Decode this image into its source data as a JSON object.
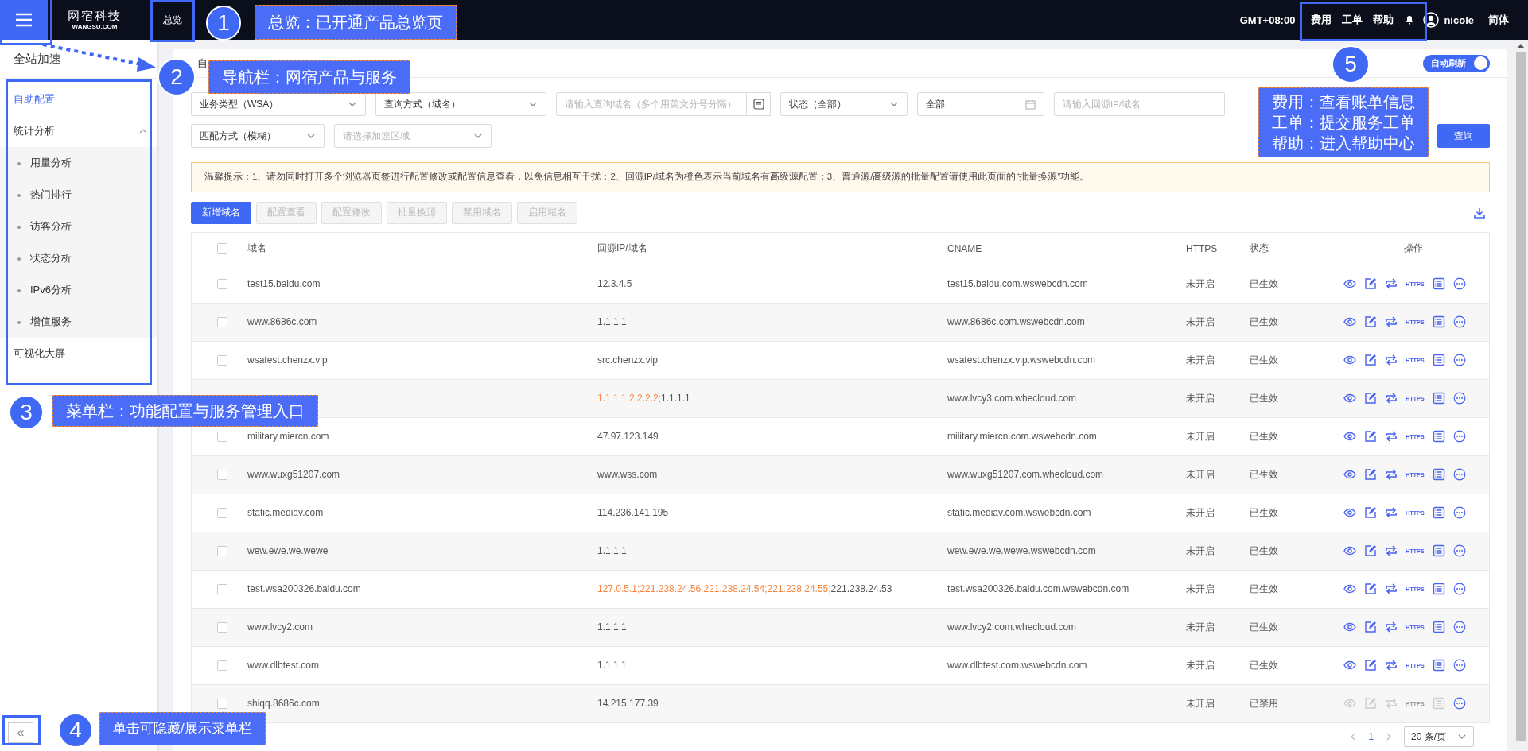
{
  "topbar": {
    "logo_cn": "网宿科技",
    "logo_en": "WANGSU.COM",
    "overview": "总览",
    "timezone": "GMT+08:00",
    "links": [
      "费用",
      "工单",
      "帮助"
    ],
    "user": "nicole",
    "language": "简体"
  },
  "sidebar": {
    "product": "全站加速",
    "items": [
      {
        "label": "自助配置",
        "selected": true
      },
      {
        "label": "统计分析",
        "selected": false,
        "expanded": true,
        "children": [
          {
            "label": "用量分析",
            "selected": false
          },
          {
            "label": "热门排行",
            "selected": false
          },
          {
            "label": "访客分析",
            "selected": false
          },
          {
            "label": "状态分析",
            "selected": false
          },
          {
            "label": "IPv6分析",
            "selected": false
          },
          {
            "label": "增值服务",
            "selected": false
          }
        ]
      },
      {
        "label": "可视化大屏",
        "selected": false
      }
    ],
    "collapse": "«"
  },
  "page": {
    "title": "自",
    "auto_refresh": {
      "label": "自动刷新",
      "on": true
    }
  },
  "filters": [
    {
      "kind": "select",
      "value": "业务类型（WSA）"
    },
    {
      "kind": "select",
      "value": "查询方式（域名）"
    },
    {
      "kind": "picker",
      "placeholder": "请输入查询域名（多个用英文分号分隔）"
    },
    {
      "kind": "select",
      "value": "状态（全部）"
    },
    {
      "kind": "date",
      "value": "全部"
    },
    {
      "kind": "input",
      "placeholder": "请输入回源IP/域名"
    },
    {
      "kind": "select",
      "value": "匹配方式（模糊）"
    },
    {
      "kind": "select",
      "placeholder": "请选择加速区域"
    }
  ],
  "search_button": "查询",
  "notice": "温馨提示：1、请勿同时打开多个浏览器页签进行配置修改或配置信息查看，以免信息相互干扰；2、回源IP/域名为橙色表示当前域名有高级源配置；3、普通源/高级源的批量配置请使用此页面的“批量换源”功能。",
  "actions": [
    {
      "label": "新增域名",
      "disabled": false
    },
    {
      "label": "配置查看",
      "disabled": true
    },
    {
      "label": "配置修改",
      "disabled": true
    },
    {
      "label": "批量换源",
      "disabled": true
    },
    {
      "label": "禁用域名",
      "disabled": true
    },
    {
      "label": "启用域名",
      "disabled": true
    }
  ],
  "table": {
    "columns": [
      "域名",
      "回源IP/域名",
      "CNAME",
      "HTTPS",
      "状态",
      "操作"
    ],
    "all_checked": false,
    "rows": [
      {
        "checked": false,
        "domain": "test15.baidu.com",
        "origin": [
          {
            "text": "12.3.4.5",
            "advanced": false
          }
        ],
        "cname": "test15.baidu.com.wswebcdn.com",
        "https": "未开启",
        "status": "已生效",
        "https_action": "HTTPS",
        "actions_disabled": false
      },
      {
        "checked": false,
        "domain": "www.8686c.com",
        "origin": [
          {
            "text": "1.1.1.1",
            "advanced": false
          }
        ],
        "cname": "www.8686c.com.wswebcdn.com",
        "https": "未开启",
        "status": "已生效",
        "https_action": "HTTPS",
        "actions_disabled": false
      },
      {
        "checked": false,
        "domain": "wsatest.chenzx.vip",
        "origin": [
          {
            "text": "src.chenzx.vip",
            "advanced": false
          }
        ],
        "cname": "wsatest.chenzx.vip.wswebcdn.com",
        "https": "未开启",
        "status": "已生效",
        "https_action": "HTTPS",
        "actions_disabled": false
      },
      {
        "origin": [
          {
            "text": "1.1.1.1;2.2.2.2;",
            "advanced": true
          },
          {
            "text": "1.1.1.1",
            "advanced": false
          }
        ],
        "cname": "www.lvcy3.com.whecloud.com",
        "https": "未开启",
        "status": "已生效",
        "https_action": "HTTPS",
        "actions_disabled": false
      },
      {
        "checked": false,
        "domain": "military.miercn.com",
        "origin": [
          {
            "text": "47.97.123.149",
            "advanced": false
          }
        ],
        "cname": "military.miercn.com.wswebcdn.com",
        "https": "未开启",
        "status": "已生效",
        "https_action": "HTTPS",
        "actions_disabled": false
      },
      {
        "checked": false,
        "domain": "www.wuxg51207.com",
        "origin": [
          {
            "text": "www.wss.com",
            "advanced": false
          }
        ],
        "cname": "www.wuxg51207.com.whecloud.com",
        "https": "未开启",
        "status": "已生效",
        "https_action": "HTTPS",
        "actions_disabled": false
      },
      {
        "checked": false,
        "domain": "static.mediav.com",
        "origin": [
          {
            "text": "114.236.141.195",
            "advanced": false
          }
        ],
        "cname": "static.mediav.com.wswebcdn.com",
        "https": "未开启",
        "status": "已生效",
        "https_action": "HTTPS",
        "actions_disabled": false
      },
      {
        "checked": false,
        "domain": "wew.ewe.we.wewe",
        "origin": [
          {
            "text": "1.1.1.1",
            "advanced": false
          }
        ],
        "cname": "wew.ewe.we.wewe.wswebcdn.com",
        "https": "未开启",
        "status": "已生效",
        "https_action": "HTTPS",
        "actions_disabled": false
      },
      {
        "checked": false,
        "domain": "test.wsa200326.baidu.com",
        "origin": [
          {
            "text": "127.0.5.1;221.238.24.56;221.238.24.54;221.238.24.55;",
            "advanced": true
          },
          {
            "text": "221.238.24.53",
            "advanced": false
          }
        ],
        "cname": "test.wsa200326.baidu.com.wswebcdn.com",
        "https": "未开启",
        "status": "已生效",
        "https_action": "HTTPS",
        "actions_disabled": false
      },
      {
        "checked": false,
        "domain": "www.lvcy2.com",
        "origin": [
          {
            "text": "1.1.1.1",
            "advanced": false
          }
        ],
        "cname": "www.lvcy2.com.whecloud.com",
        "https": "未开启",
        "status": "已生效",
        "https_action": "HTTPS",
        "actions_disabled": false
      },
      {
        "checked": false,
        "domain": "www.dlbtest.com",
        "origin": [
          {
            "text": "1.1.1.1",
            "advanced": false
          }
        ],
        "cname": "www.dlbtest.com.wswebcdn.com",
        "https": "未开启",
        "status": "已生效",
        "https_action": "HTTPS",
        "actions_disabled": false
      },
      {
        "checked": false,
        "domain": "shiqq.8686c.com",
        "origin": [
          {
            "text": "14.215.177.39",
            "advanced": false
          }
        ],
        "https": "未开启",
        "status": "已禁用",
        "https_action": "HTTPS",
        "actions_disabled": true
      }
    ]
  },
  "pagination": {
    "current": "1",
    "page_size": "20 条/页"
  },
  "annotations": [
    {
      "number": "1",
      "lines": [
        "总览：已开通产品总览页"
      ]
    },
    {
      "number": "2",
      "lines": [
        "导航栏：网宿产品与服务"
      ]
    },
    {
      "number": "3",
      "lines": [
        "菜单栏：功能配置与服务管理入口"
      ]
    },
    {
      "number": "4",
      "lines": [
        "单击可隐藏/展示菜单栏"
      ]
    },
    {
      "number": "5",
      "lines": [
        "费用：查看账单信息",
        "工单：提交服务工单",
        "帮助：进入帮助中心"
      ]
    }
  ]
}
